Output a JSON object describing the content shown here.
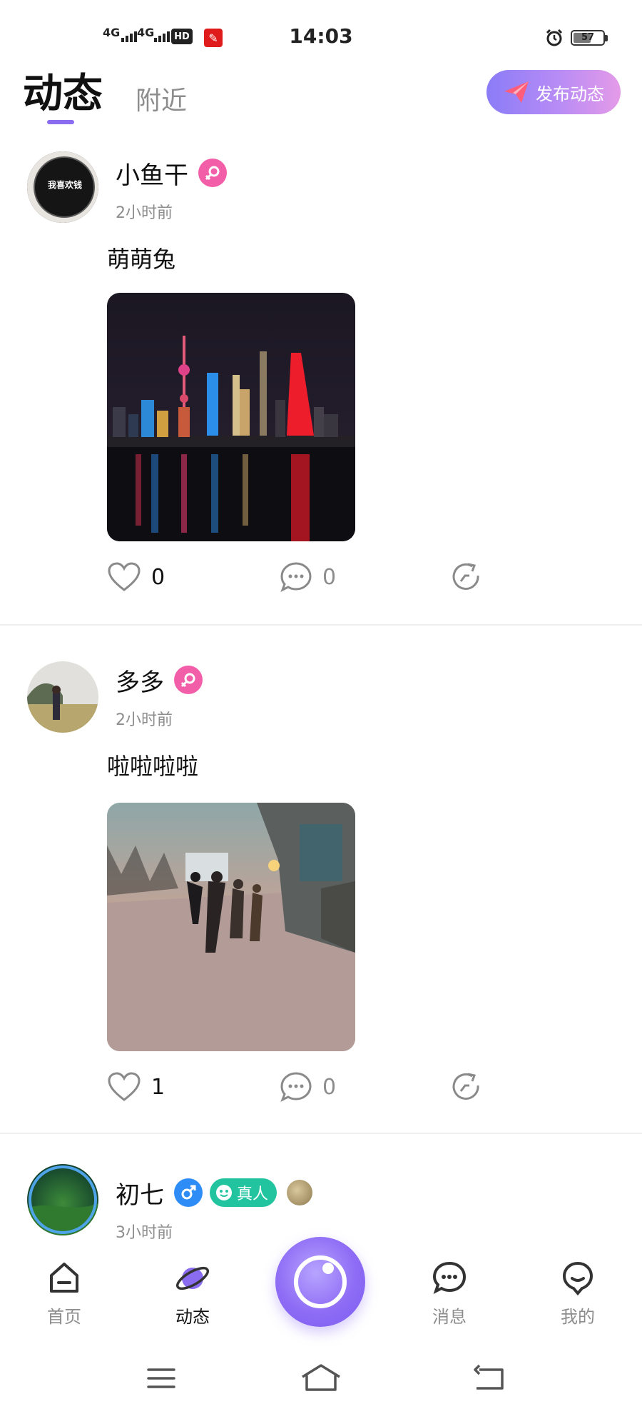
{
  "status_bar": {
    "network_1": "4G",
    "network_2": "4G",
    "hd": "HD",
    "time": "14:03",
    "battery": "57"
  },
  "header": {
    "tab_active": "动态",
    "tab_nearby": "附近",
    "publish_button": "发布动态",
    "accent_color": "#8a6cf0"
  },
  "posts": [
    {
      "username": "小鱼干",
      "gender": "female",
      "time": "2小时前",
      "text": "萌萌兔",
      "avatar_caption": "我喜欢钱",
      "likes": "0",
      "comments": "0"
    },
    {
      "username": "多多",
      "gender": "female",
      "time": "2小时前",
      "text": "啦啦啦啦",
      "likes": "1",
      "comments": "0"
    },
    {
      "username": "初七",
      "gender": "male",
      "badge": "真人",
      "time": "3小时前"
    }
  ],
  "bottom_nav": {
    "items": [
      {
        "label": "首页",
        "icon": "home-icon"
      },
      {
        "label": "动态",
        "icon": "planet-icon",
        "active": true
      },
      {
        "label": "",
        "icon": "camera-center-icon"
      },
      {
        "label": "消息",
        "icon": "message-icon"
      },
      {
        "label": "我的",
        "icon": "profile-icon"
      }
    ]
  }
}
